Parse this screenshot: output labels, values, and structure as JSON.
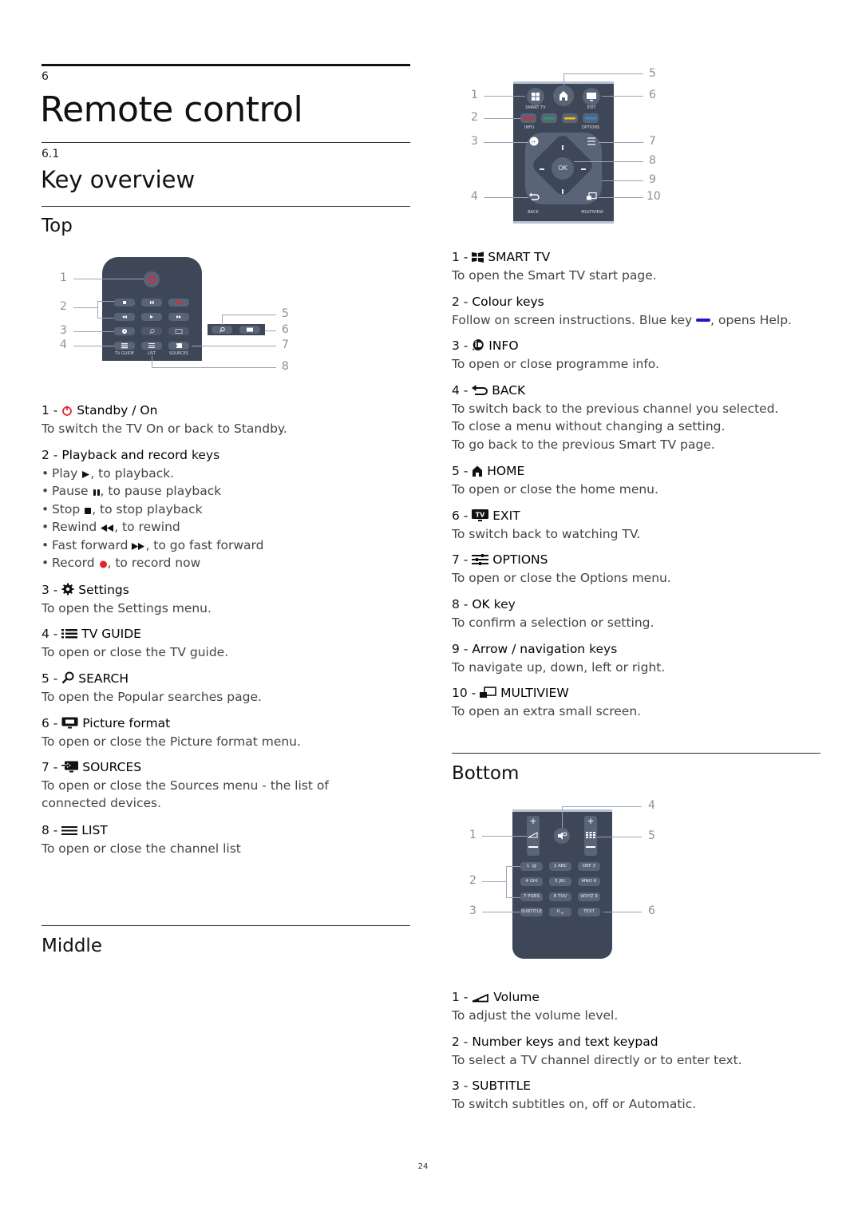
{
  "chapter": {
    "number": "6",
    "title": "Remote control"
  },
  "section": {
    "number": "6.1",
    "title": "Key overview"
  },
  "top": {
    "heading": "Top",
    "callouts": [
      "1",
      "2",
      "3",
      "4",
      "5",
      "6",
      "7",
      "8"
    ],
    "remote_labels": {
      "tv_guide": "TV GUIDE",
      "list": "LIST",
      "sources": "SOURCES"
    },
    "items": [
      {
        "num": "1",
        "icon": "power-icon",
        "title": "Standby / On",
        "desc": "To switch the TV On or back to Standby."
      },
      {
        "num": "2",
        "title": "Playback and record",
        "title_suffix": "keys",
        "bullets": [
          {
            "pre": "Play",
            "icon": "play-icon",
            "post": ", to playback."
          },
          {
            "pre": "Pause",
            "icon": "pause-icon",
            "post": ", to pause playback"
          },
          {
            "pre": "Stop",
            "icon": "stop-icon",
            "post": ", to stop playback"
          },
          {
            "pre": "Rewind",
            "icon": "rewind-icon",
            "post": ", to rewind"
          },
          {
            "pre": "Fast forward",
            "icon": "fast-forward-icon",
            "post": ", to go fast forward"
          },
          {
            "pre": "Record",
            "icon": "record-icon",
            "post": ", to record now"
          }
        ]
      },
      {
        "num": "3",
        "icon": "settings-gear-icon",
        "title": "Settings",
        "desc": "To open the Settings menu."
      },
      {
        "num": "4",
        "icon": "tv-guide-icon",
        "title": "TV GUIDE",
        "desc": "To open or close the TV guide."
      },
      {
        "num": "5",
        "icon": "search-icon",
        "title": "SEARCH",
        "desc": "To open the Popular searches page."
      },
      {
        "num": "6",
        "icon": "picture-format-icon",
        "title": "Picture format",
        "desc": "To open or close the Picture format menu."
      },
      {
        "num": "7",
        "icon": "sources-icon",
        "title": "SOURCES",
        "desc": "To open or close the Sources menu - the list of connected devices."
      },
      {
        "num": "8",
        "icon": "list-icon",
        "title": "LIST",
        "desc": "To open or close the channel list"
      }
    ]
  },
  "middle": {
    "heading": "Middle",
    "callouts": [
      "1",
      "2",
      "3",
      "4",
      "5",
      "6",
      "7",
      "8",
      "9",
      "10"
    ],
    "remote_labels": {
      "smart_tv": "SMART TV",
      "exit": "EXIT",
      "info": "INFO",
      "options": "OPTIONS",
      "ok": "OK",
      "back": "BACK",
      "multiview": "MULTIVIEW",
      "exit_badge": "TV"
    },
    "colour_keys": [
      "#e3262d",
      "#1fa35c",
      "#f1c40f",
      "#1f8fe0"
    ],
    "items": [
      {
        "num": "1",
        "icon": "smart-tv-icon",
        "title": "SMART TV",
        "desc": "To open the Smart TV start page."
      },
      {
        "num": "2",
        "title": "Colour keys",
        "desc_pre": "Follow on screen instructions. Blue key",
        "desc_icon": "blue-key-icon",
        "desc_post": ", opens Help."
      },
      {
        "num": "3",
        "icon": "info-icon",
        "title": "INFO",
        "desc": "To open or close programme info."
      },
      {
        "num": "4",
        "icon": "back-icon",
        "title": "BACK",
        "desc_lines": [
          "To switch back to the previous channel you selected.",
          "To close a menu without changing a setting.",
          "To go back to the previous Smart TV page."
        ]
      },
      {
        "num": "5",
        "icon": "home-icon",
        "title": "HOME",
        "desc": "To open or close the home menu."
      },
      {
        "num": "6",
        "icon": "exit-tv-icon",
        "title": "EXIT",
        "desc": "To switch back to watching TV."
      },
      {
        "num": "7",
        "icon": "options-icon",
        "title": "OPTIONS",
        "desc": "To open or close the Options menu."
      },
      {
        "num": "8",
        "title": "OK",
        "title_suffix": "key",
        "desc": "To confirm a selection or setting."
      },
      {
        "num": "9",
        "title": "Arrow / navigation",
        "title_suffix": "keys",
        "desc": "To navigate up, down, left or right."
      },
      {
        "num": "10",
        "icon": "multiview-icon",
        "title": "MULTIVIEW",
        "desc": "To open an extra small screen."
      }
    ]
  },
  "bottom": {
    "heading": "Bottom",
    "callouts": [
      "1",
      "2",
      "3",
      "4",
      "5",
      "6"
    ],
    "keypad": [
      [
        "1 .@",
        "2 ABC",
        "DEF 3"
      ],
      [
        "4 GHI",
        "5 JKL",
        "MNO 6"
      ],
      [
        "7 PQRS",
        "8 TUV",
        "WXYZ 9"
      ],
      [
        "SUBTITLE",
        "0 ␣",
        "TEXT"
      ]
    ],
    "items": [
      {
        "num": "1",
        "icon": "volume-icon",
        "title": "Volume",
        "desc": "To adjust the volume level."
      },
      {
        "num": "2",
        "title": "Number keys",
        "title_mid": "and",
        "title2": "text keypad",
        "desc": "To select a TV channel directly or to enter text."
      },
      {
        "num": "3",
        "title": "SUBTITLE",
        "desc": "To switch subtitles on, off or Automatic."
      }
    ]
  },
  "page_number": "24",
  "colors": {
    "remote_body": "#3e4758",
    "key": "#5a6477",
    "accent_red": "#e3262d",
    "callout_line": "#9aa4b8"
  }
}
